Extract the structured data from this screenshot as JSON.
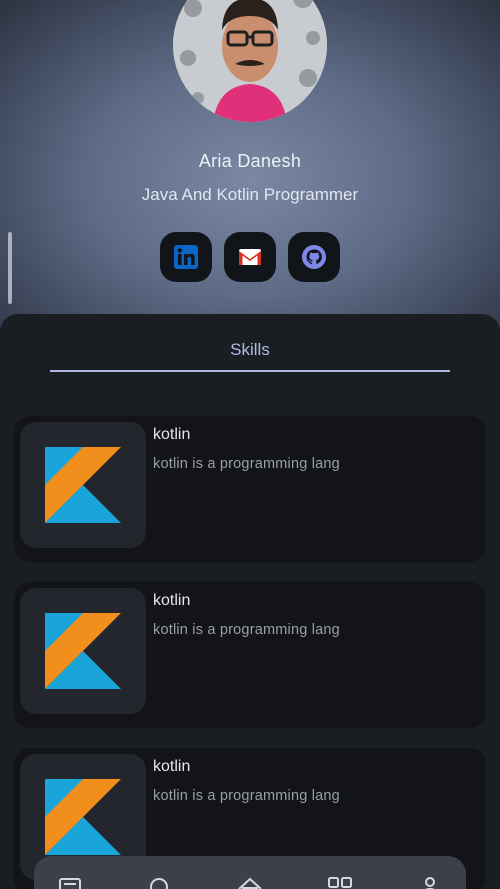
{
  "profile": {
    "name": "Aria Danesh",
    "title": "Java And Kotlin Programmer"
  },
  "socials": [
    {
      "icon": "linkedin-icon",
      "color": "#0a66c2"
    },
    {
      "icon": "gmail-icon",
      "color": "#d93025"
    },
    {
      "icon": "github-icon",
      "color": "#7e88e6"
    }
  ],
  "tabs": [
    {
      "label": "Skills",
      "selected": true
    }
  ],
  "skills": [
    {
      "title": "kotlin",
      "description": "kotlin is a programming lang",
      "icon": "kotlin-logo-icon"
    },
    {
      "title": "kotlin",
      "description": "kotlin is a programming lang",
      "icon": "kotlin-logo-icon"
    },
    {
      "title": "kotlin",
      "description": "kotlin is a programming lang",
      "icon": "kotlin-logo-icon"
    }
  ],
  "bottom_nav": [
    {
      "icon": "article-icon"
    },
    {
      "icon": "search-icon"
    },
    {
      "icon": "home-icon"
    },
    {
      "icon": "grid-icon"
    },
    {
      "icon": "person-icon"
    }
  ],
  "colors": {
    "accent": "#aebbe6",
    "kotlin_orange": "#f18e1c",
    "kotlin_blue": "#1aa5da"
  }
}
